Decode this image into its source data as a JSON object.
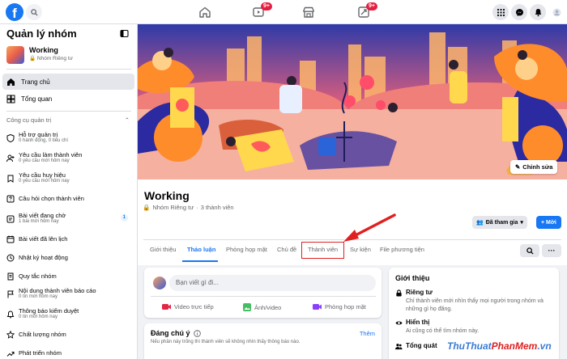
{
  "colors": {
    "accent": "#1877f2",
    "highlight": "#e02020",
    "badge": "#e41e3f"
  },
  "topbar": {
    "logo": "f",
    "tabs": [
      {
        "icon": "home-icon",
        "badge": ""
      },
      {
        "icon": "video-icon",
        "badge": "9+"
      },
      {
        "icon": "marketplace-icon",
        "badge": ""
      },
      {
        "icon": "gaming-icon",
        "badge": "9+"
      }
    ],
    "right_icons": [
      "menu-grid-icon",
      "messenger-icon",
      "bell-icon",
      "account-icon"
    ]
  },
  "sidebar": {
    "title": "Quản lý nhóm",
    "group": {
      "name": "Working",
      "privacy": "Nhóm Riêng tư"
    },
    "nav": [
      {
        "label": "Trang chủ",
        "icon": "home-icon",
        "active": true
      },
      {
        "label": "Tổng quan",
        "icon": "overview-icon",
        "active": false
      }
    ],
    "tools_header": "Công cụ quản trị",
    "tools": [
      {
        "label": "Hỗ trợ quản trị",
        "sub": "0 hành động, 0 tiêu chí",
        "icon": "admin-assist-icon",
        "count": ""
      },
      {
        "label": "Yêu cầu làm thành viên",
        "sub": "0 yêu cầu mới hôm nay",
        "icon": "member-request-icon",
        "count": ""
      },
      {
        "label": "Yêu cầu huy hiệu",
        "sub": "0 yêu cầu mới hôm nay",
        "icon": "badge-request-icon",
        "count": ""
      },
      {
        "label": "Câu hỏi chọn thành viên",
        "sub": "",
        "icon": "question-icon",
        "count": ""
      },
      {
        "label": "Bài viết đang chờ",
        "sub": "1 bài mới hôm nay",
        "icon": "pending-post-icon",
        "count": "1"
      },
      {
        "label": "Bài viết đã lên lịch",
        "sub": "",
        "icon": "scheduled-post-icon",
        "count": ""
      },
      {
        "label": "Nhật ký hoạt động",
        "sub": "",
        "icon": "activity-log-icon",
        "count": ""
      },
      {
        "label": "Quy tắc nhóm",
        "sub": "",
        "icon": "rules-icon",
        "count": ""
      },
      {
        "label": "Nội dung thành viên báo cáo",
        "sub": "0 tin mới hôm nay",
        "icon": "report-icon",
        "count": ""
      },
      {
        "label": "Thông báo kiểm duyệt",
        "sub": "0 tin mới hôm nay",
        "icon": "moderation-alert-icon",
        "count": ""
      },
      {
        "label": "Chất lượng nhóm",
        "sub": "",
        "icon": "quality-icon",
        "count": ""
      },
      {
        "label": "Phát triển nhóm",
        "sub": "",
        "icon": "growth-icon",
        "count": ""
      }
    ]
  },
  "main": {
    "edit_cover": "Chỉnh sửa",
    "group_title": "Working",
    "privacy": "Nhóm Riêng tư",
    "members_count": "3 thành viên",
    "joined_label": "Đã tham gia",
    "new_label": "+ Mời",
    "tabs": [
      "Giới thiệu",
      "Thảo luận",
      "Phòng họp mặt",
      "Chủ đề",
      "Thành viên",
      "Sự kiện",
      "File phương tiện"
    ],
    "composer": {
      "placeholder": "Bạn viết gì đi...",
      "actions": [
        "Video trực tiếp",
        "Ảnh/video",
        "Phòng họp mặt"
      ]
    },
    "notice": {
      "title": "Đáng chú ý",
      "more": "Thêm",
      "sub": "Nếu phần này trống thì thành viên sẽ không nhìn thấy thông báo nào."
    },
    "about": {
      "title": "Giới thiệu",
      "rows": [
        {
          "title": "Riêng tư",
          "desc": "Chỉ thành viên mới nhìn thấy mọi người trong nhóm và những gì họ đăng."
        },
        {
          "title": "Hiển thị",
          "desc": "Ai cũng có thể tìm nhóm này."
        },
        {
          "title": "Tổng quát",
          "desc": ""
        }
      ]
    }
  },
  "watermark": {
    "part1": "ThuThuat",
    "part2": "PhanMem",
    "part3": ".vn"
  }
}
